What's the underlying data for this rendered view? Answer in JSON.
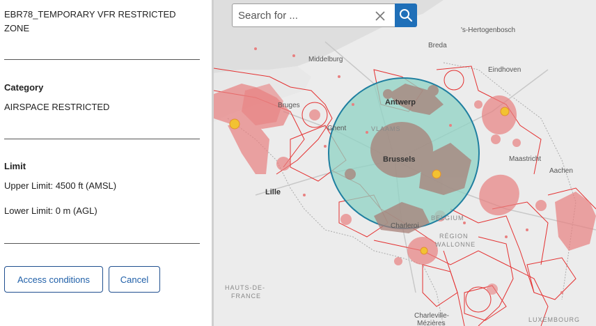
{
  "panel": {
    "title": "EBR78_TEMPORARY VFR RESTRICTED ZONE",
    "category_label": "Category",
    "category_value": "AIRSPACE RESTRICTED",
    "limit_label": "Limit",
    "upper_limit": "Upper Limit: 4500 ft (AMSL)",
    "lower_limit": "Lower Limit: 0 m (AGL)",
    "access_button": "Access conditions",
    "cancel_button": "Cancel"
  },
  "search": {
    "placeholder": "Search for ...",
    "value": ""
  },
  "map": {
    "labels": {
      "hertogenbosch": "'s-Hertogenbosch",
      "breda": "Breda",
      "middelburg": "Middelburg",
      "eindhoven": "Eindhoven",
      "bruges": "Bruges",
      "antwerp": "Antwerp",
      "ghent": "Ghent",
      "vlaanderen": "VLAAMS",
      "brussels": "Brussels",
      "maastricht": "Maastricht",
      "aachen": "Aachen",
      "lille": "Lille",
      "belgium": "BELGIUM",
      "charleroi": "Charleroi",
      "wallonie_1": "RÉGION",
      "wallonie_2": "WALLONNE",
      "hauts_1": "HAUTS-DE-",
      "hauts_2": "FRANCE",
      "charleville_1": "Charleville-",
      "charleville_2": "Mézières",
      "luxembourg": "LUXEMBOURG"
    },
    "colors": {
      "selected_fill": "#8fd3c4",
      "selected_stroke": "#1f7fa0",
      "restricted_fill": "#e88080",
      "restricted_stroke": "#e43030",
      "danger_fill": "#a88078",
      "marker": "#f2c232"
    }
  }
}
